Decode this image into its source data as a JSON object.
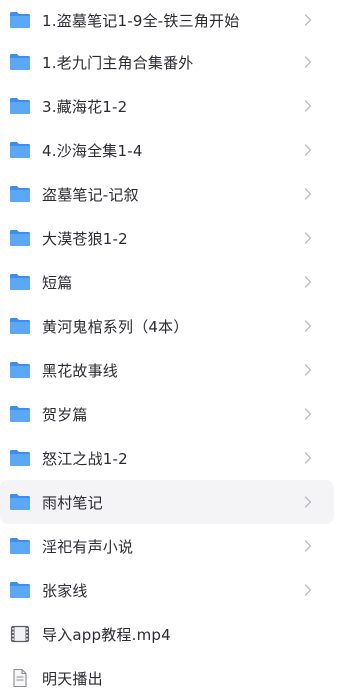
{
  "colors": {
    "folder_back": "#3e8ef0",
    "folder_front": "#5aa8f6",
    "text": "#2b2b33",
    "chevron": "#b9bbc2",
    "selected_bg": "#f4f4f6"
  },
  "items": [
    {
      "label": "1.盗墓笔记1-9全-铁三角开始",
      "icon": "folder-icon",
      "selected": false
    },
    {
      "label": "1.老九门主角合集番外",
      "icon": "folder-icon",
      "selected": false
    },
    {
      "label": "3.藏海花1-2",
      "icon": "folder-icon",
      "selected": false
    },
    {
      "label": "4.沙海全集1-4",
      "icon": "folder-icon",
      "selected": false
    },
    {
      "label": "盗墓笔记-记叙",
      "icon": "folder-icon",
      "selected": false
    },
    {
      "label": "大漠苍狼1-2",
      "icon": "folder-icon",
      "selected": false
    },
    {
      "label": "短篇",
      "icon": "folder-icon",
      "selected": false
    },
    {
      "label": "黄河鬼棺系列（4本）",
      "icon": "folder-icon",
      "selected": false
    },
    {
      "label": "黑花故事线",
      "icon": "folder-icon",
      "selected": false
    },
    {
      "label": "贺岁篇",
      "icon": "folder-icon",
      "selected": false
    },
    {
      "label": "怒江之战1-2",
      "icon": "folder-icon",
      "selected": false
    },
    {
      "label": "雨村笔记",
      "icon": "folder-icon",
      "selected": true
    },
    {
      "label": "淫祀有声小说",
      "icon": "folder-icon",
      "selected": false
    },
    {
      "label": "张家线",
      "icon": "folder-icon",
      "selected": false
    },
    {
      "label": "导入app教程.mp4",
      "icon": "video-file-icon",
      "selected": false
    },
    {
      "label": "明天播出",
      "icon": "document-file-icon",
      "selected": false
    }
  ]
}
